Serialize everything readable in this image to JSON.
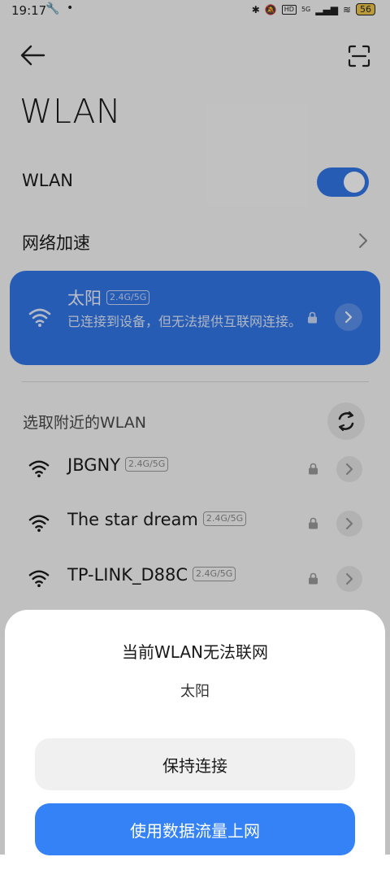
{
  "status_bar": {
    "time": "19:17",
    "battery": "56",
    "network": "5G",
    "hd": "HD"
  },
  "header": {
    "title": "WLAN"
  },
  "wlan_toggle": {
    "label": "WLAN",
    "enabled": true
  },
  "network_acceleration": {
    "label": "网络加速"
  },
  "connected_network": {
    "name": "太阳",
    "band": "2.4G/5G",
    "status": "已连接到设备，但无法提供互联网连接。"
  },
  "nearby": {
    "section_label": "选取附近的WLAN",
    "networks": [
      {
        "name": "JBGNY",
        "band": "2.4G/5G"
      },
      {
        "name": "The star dream",
        "band": "2.4G/5G"
      },
      {
        "name": "TP-LINK_D88C",
        "band": "2.4G/5G"
      }
    ]
  },
  "dialog": {
    "title": "当前WLAN无法联网",
    "network_name": "太阳",
    "keep_button": "保持连接",
    "use_data_button": "使用数据流量上网"
  },
  "colors": {
    "accent": "#3277e8",
    "primary_button": "#3482f5"
  }
}
